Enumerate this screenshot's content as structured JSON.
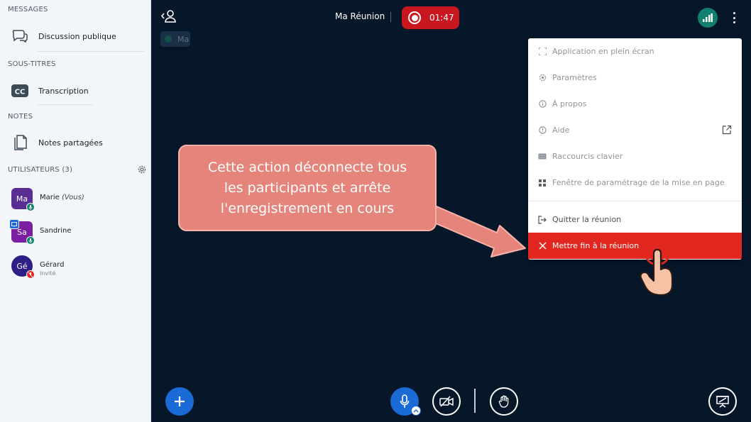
{
  "sidebar": {
    "messages_title": "MESSAGES",
    "public_chat": "Discussion publique",
    "captions_title": "SOUS-TITRES",
    "transcription": "Transcription",
    "notes_title": "NOTES",
    "shared_notes": "Notes partagées",
    "users_title": "UTILISATEURS (3)",
    "users": [
      {
        "initials": "Ma",
        "name": "Marie",
        "suffix": "(Vous)",
        "role": "",
        "color": "#5a2d91"
      },
      {
        "initials": "Sa",
        "name": "Sandrine",
        "suffix": "",
        "role": "",
        "color": "#7a1fa2"
      },
      {
        "initials": "Gé",
        "name": "Gérard",
        "suffix": "",
        "role": "Invité",
        "color": "#2e1f86"
      }
    ]
  },
  "topbar": {
    "meeting_title": "Ma Réunion",
    "recording_time": "01:47",
    "presenter_badge": "Ma"
  },
  "menu": {
    "items": [
      {
        "label": "Application en plein écran",
        "icon": "fullscreen-icon"
      },
      {
        "label": "Paramètres",
        "icon": "gear-icon"
      },
      {
        "label": "À propos",
        "icon": "info-icon"
      },
      {
        "label": "Aide",
        "icon": "help-icon"
      },
      {
        "label": "Raccourcis clavier",
        "icon": "keyboard-icon"
      },
      {
        "label": "Fenêtre de paramétrage de la mise en page",
        "icon": "layout-icon"
      }
    ],
    "leave": "Quitter la réunion",
    "end": "Mettre fin à la réunion"
  },
  "callout": {
    "line1": "Cette action déconnecte tous",
    "line2": "les participants et arrête",
    "line3": "l'enregistrement en cours"
  },
  "colors": {
    "background": "#06172a",
    "accent_blue": "#1b6bd6",
    "record_red": "#c8171e",
    "danger_red": "#e1271f",
    "callout": "#e5847a",
    "connection_green": "#12806f"
  }
}
